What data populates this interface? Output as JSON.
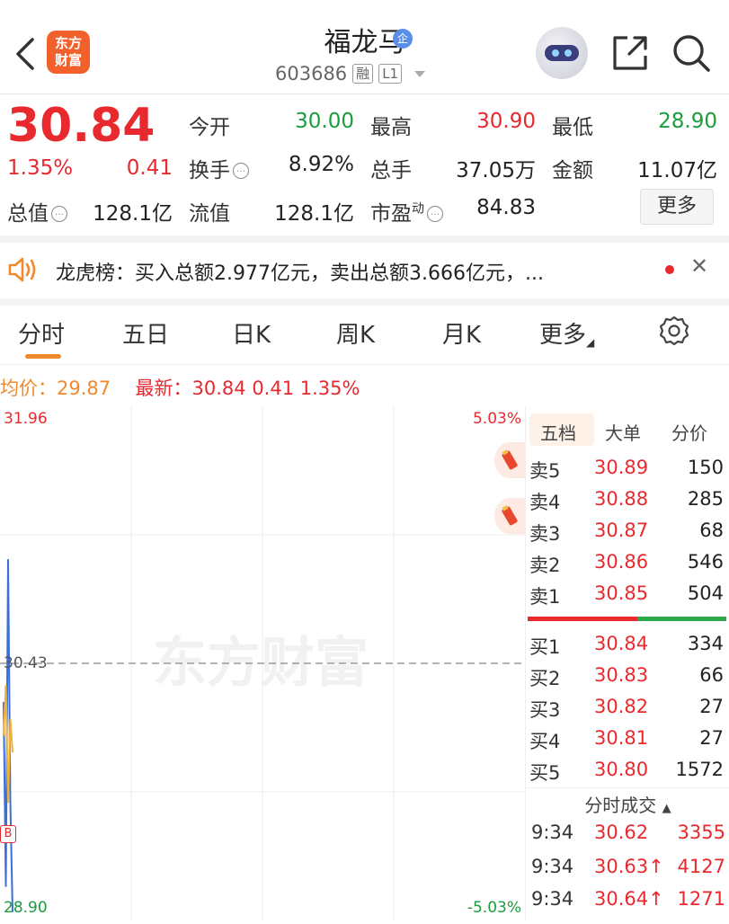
{
  "header": {
    "logo_line1": "东方",
    "logo_line2": "财富",
    "stock_name": "福龙马",
    "badge": "企",
    "stock_code": "603686",
    "tag_margin": "融",
    "tag_level": "L1"
  },
  "quote": {
    "price": "30.84",
    "change_pct": "1.35%",
    "change_amt": "0.41",
    "open_label": "今开",
    "open_value": "30.00",
    "high_label": "最高",
    "high_value": "30.90",
    "low_label": "最低",
    "low_value": "28.90",
    "turnover_label": "换手",
    "turnover_value": "8.92%",
    "volume_label": "总手",
    "volume_value": "37.05万",
    "amount_label": "金额",
    "amount_value": "11.07亿",
    "mktcap_label": "总值",
    "mktcap_value": "128.1亿",
    "float_label": "流值",
    "float_value": "128.1亿",
    "pe_label": "市盈",
    "pe_sup": "动",
    "pe_value": "84.83",
    "more_label": "更多"
  },
  "ticker": {
    "text": "龙虎榜：买入总额2.977亿元，卖出总额3.666亿元，..."
  },
  "tabs": [
    {
      "label": "分时"
    },
    {
      "label": "五日"
    },
    {
      "label": "日K"
    },
    {
      "label": "周K"
    },
    {
      "label": "月K"
    },
    {
      "label": "更多"
    }
  ],
  "avg_row": {
    "avg_label": "均价：",
    "avg_value": "29.87",
    "latest_label": "最新：",
    "latest_value": "30.84",
    "latest_chg": "0.41",
    "latest_pct": "1.35%"
  },
  "chart": {
    "y_top": "31.96",
    "y_mid": "30.43",
    "y_bottom": "28.90",
    "pct_top": "5.03%",
    "pct_bottom": "-5.03%",
    "watermark": "东方财富",
    "marker": "B"
  },
  "chart_data": {
    "type": "line",
    "title": "",
    "ylim": [
      28.9,
      31.96
    ],
    "reference_price": 30.43,
    "series": [
      {
        "name": "",
        "color": "#3b6fd6",
        "values": [
          30.2,
          29.1,
          31.05,
          29.6,
          28.95
        ]
      },
      {
        "name": "",
        "color": "#f0b23a",
        "values": [
          30.0,
          30.3,
          29.6,
          30.1,
          29.9
        ]
      }
    ],
    "grid": true
  },
  "order_book": {
    "tabs": [
      "五档",
      "大单",
      "分价"
    ],
    "asks": [
      {
        "side": "卖5",
        "price": "30.89",
        "volume": "150"
      },
      {
        "side": "卖4",
        "price": "30.88",
        "volume": "285"
      },
      {
        "side": "卖3",
        "price": "30.87",
        "volume": "68"
      },
      {
        "side": "卖2",
        "price": "30.86",
        "volume": "546"
      },
      {
        "side": "卖1",
        "price": "30.85",
        "volume": "504"
      }
    ],
    "bids": [
      {
        "side": "买1",
        "price": "30.84",
        "volume": "334"
      },
      {
        "side": "买2",
        "price": "30.83",
        "volume": "66"
      },
      {
        "side": "买3",
        "price": "30.82",
        "volume": "27"
      },
      {
        "side": "买4",
        "price": "30.81",
        "volume": "27"
      },
      {
        "side": "买5",
        "price": "30.80",
        "volume": "1572"
      }
    ],
    "trades_header": "分时成交",
    "trades": [
      {
        "time": "9:34",
        "price": "30.62",
        "volume": "3355"
      },
      {
        "time": "9:34",
        "price": "30.63↑",
        "volume": "4127"
      },
      {
        "time": "9:34",
        "price": "30.64↑",
        "volume": "1271"
      }
    ]
  },
  "colors": {
    "up": "#e8292e",
    "down": "#1a9d3c",
    "accent": "#f0892e"
  }
}
